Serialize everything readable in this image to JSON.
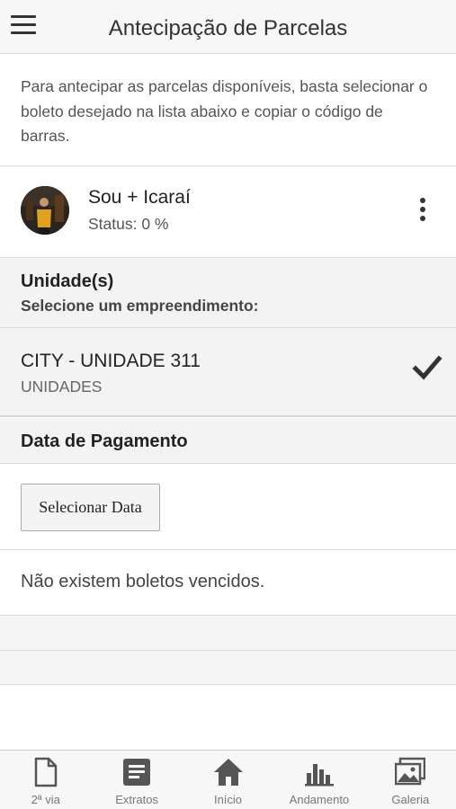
{
  "header": {
    "title": "Antecipação de Parcelas",
    "menu_icon": "hamburger-icon"
  },
  "intro": {
    "text": "Para antecipar as parcelas disponíveis, basta selecionar o boleto desejado na lista abaixo e copiar o código de barras."
  },
  "project": {
    "name": "Sou + Icaraí",
    "status": "Status: 0 %"
  },
  "units_section": {
    "title": "Unidade(s)",
    "subtitle": "Selecione um empreendimento:"
  },
  "unit": {
    "name": "CITY - UNIDADE 311",
    "type": "UNIDADES",
    "selected": true
  },
  "date_section": {
    "title": "Data de Pagamento",
    "button_label": "Selecionar Data"
  },
  "message": "Não existem boletos vencidos.",
  "bottom_nav": [
    {
      "label": "2ª via",
      "icon": "document-icon"
    },
    {
      "label": "Extratos",
      "icon": "statement-icon"
    },
    {
      "label": "Início",
      "icon": "home-icon"
    },
    {
      "label": "Andamento",
      "icon": "bar-chart-icon"
    },
    {
      "label": "Galeria",
      "icon": "gallery-icon"
    }
  ],
  "colors": {
    "header_bg": "#f7f7f7",
    "section_bg": "#f3f3f3",
    "icon_dark": "#333333",
    "nav_icon": "#555555"
  }
}
